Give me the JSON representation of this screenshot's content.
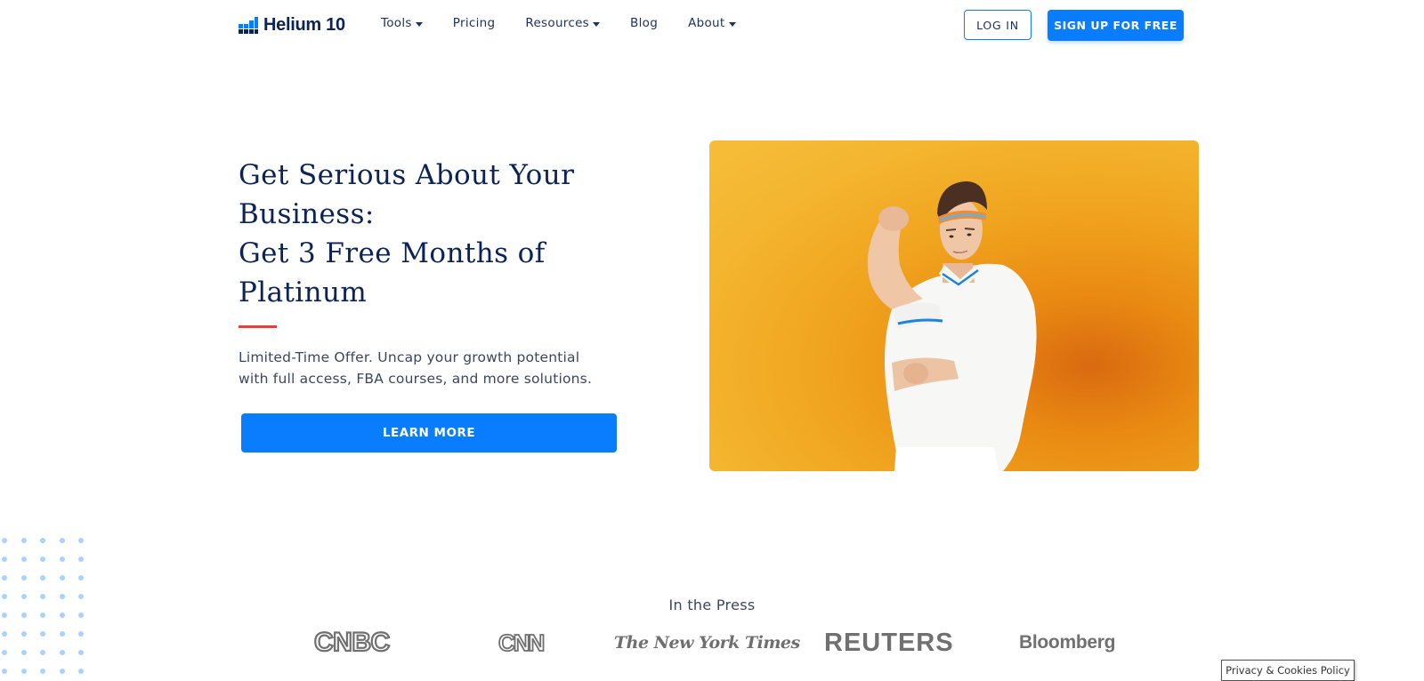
{
  "nav": {
    "brand": "Helium 10",
    "items": [
      {
        "label": "Tools",
        "dropdown": true
      },
      {
        "label": "Pricing",
        "dropdown": false
      },
      {
        "label": "Resources",
        "dropdown": true
      },
      {
        "label": "Blog",
        "dropdown": false
      },
      {
        "label": "About",
        "dropdown": true
      }
    ],
    "login_label": "LOG IN",
    "signup_label": "SIGN UP FOR FREE"
  },
  "hero": {
    "title_lines": [
      "Get Serious About Your",
      "Business:",
      "Get 3 Free Months of",
      "Platinum"
    ],
    "subtitle_lines": [
      "Limited-Time Offer. Uncap your growth potential",
      "with full access, FBA courses, and more solutions."
    ],
    "cta_label": "LEARN MORE"
  },
  "press": {
    "title": "In the Press",
    "logos": [
      "CNBC",
      "CNN",
      "The New York Times",
      "REUTERS",
      "Bloomberg"
    ]
  },
  "footer": {
    "privacy_label": "Privacy & Cookies Policy"
  },
  "colors": {
    "primary": "#0a7dff",
    "navy": "#0b2355",
    "accent_red": "#e5403a",
    "hero_orange": "#f4b52f"
  }
}
